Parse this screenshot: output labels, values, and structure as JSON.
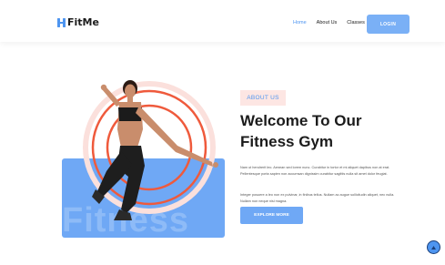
{
  "brand": {
    "name": "FitMe",
    "accent": "#4e95f0"
  },
  "nav": {
    "items": [
      {
        "label": "Home",
        "active": true
      },
      {
        "label": "About Us",
        "active": false
      },
      {
        "label": "Classes",
        "active": false
      }
    ],
    "login_label": "LOGIN"
  },
  "hero": {
    "watermark": "Fitness",
    "tag": "ABOUT US",
    "title_line1": "Welcome To Our",
    "title_line2": "Fitness Gym",
    "paragraph1": "Nam ut hendrerit leo. Aenean sed lorem nunc. Curabitur in tortor et mi aliquet dapibus non at erat. Pellentesque porta sapien non accumsan dignissim curabitur sagittis nulla sit amet dolor feugiat.",
    "paragraph2": "Integer posuere a leo non ex pulvinar, in finibus tellus. Nullam ac augue sollicitudin aliquet, nec nulla. Nullam non neque nisi magna.",
    "cta_label": "EXPLORE MORE"
  },
  "icons": {
    "logo": "dumbbell-icon",
    "scroll_top": "arrow-up-icon"
  }
}
